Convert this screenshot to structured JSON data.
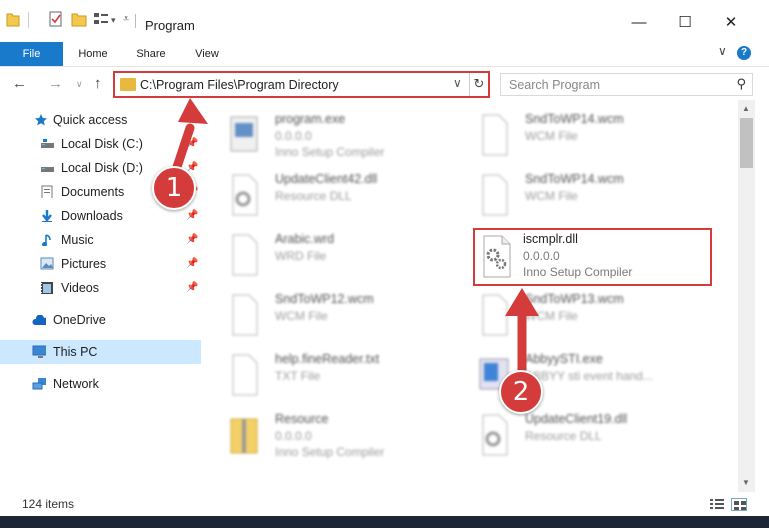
{
  "window": {
    "title": "Program",
    "minimize_glyph": "—",
    "maximize_glyph": "☐",
    "close_glyph": "✕"
  },
  "ribbon": {
    "tabs": [
      "File",
      "Home",
      "Share",
      "View"
    ],
    "expand_glyph": "∨",
    "help_glyph": "?"
  },
  "nav": {
    "back_glyph": "←",
    "forward_glyph": "→",
    "recent_glyph": "∨",
    "up_glyph": "↑",
    "address": "C:\\Program Files\\Program Directory",
    "address_dropdown_glyph": "∨",
    "refresh_glyph": "↻",
    "search_placeholder": "Search Program",
    "search_glyph": "⚲"
  },
  "sidebar": {
    "items": [
      {
        "label": "Quick access",
        "icon": "star-icon"
      },
      {
        "label": "Local Disk (C:)",
        "icon": "drive-icon",
        "pinned": true
      },
      {
        "label": "Local Disk (D:)",
        "icon": "drive-icon",
        "pinned": true
      },
      {
        "label": "Documents",
        "icon": "documents-icon",
        "pinned": true
      },
      {
        "label": "Downloads",
        "icon": "downloads-icon",
        "pinned": true
      },
      {
        "label": "Music",
        "icon": "music-icon",
        "pinned": true
      },
      {
        "label": "Pictures",
        "icon": "pictures-icon",
        "pinned": true
      },
      {
        "label": "Videos",
        "icon": "videos-icon",
        "pinned": true
      },
      {
        "label": "OneDrive",
        "icon": "onedrive-icon"
      },
      {
        "label": "This PC",
        "icon": "pc-icon",
        "selected": true
      },
      {
        "label": "Network",
        "icon": "network-icon"
      }
    ]
  },
  "files": {
    "left": [
      {
        "name": "program.exe",
        "line2": "0.0.0.0",
        "line3": "Inno Setup Compiler",
        "icon": "exe-icon"
      },
      {
        "name": "UpdateClient42.dll",
        "line2": "Resource DLL",
        "line3": "",
        "icon": "dll-icon"
      },
      {
        "name": "Arabic.wrd",
        "line2": "WRD File",
        "line3": "",
        "icon": "file-icon"
      },
      {
        "name": "SndToWP12.wcm",
        "line2": "WCM File",
        "line3": "",
        "icon": "file-icon"
      },
      {
        "name": "help.fineReader.txt",
        "line2": "TXT File",
        "line3": "",
        "icon": "file-icon"
      },
      {
        "name": "Resource",
        "line2": "0.0.0.0",
        "line3": "Inno Setup Compiler",
        "icon": "archive-icon"
      }
    ],
    "right": [
      {
        "name": "SndToWP14.wcm",
        "line2": "WCM File",
        "line3": "",
        "icon": "file-icon"
      },
      {
        "name": "SndToWP14.wcm",
        "line2": "WCM File",
        "line3": "",
        "icon": "file-icon"
      },
      {
        "name": "SndToWP13.wcm",
        "line2": "WCM File",
        "line3": "",
        "icon": "file-icon"
      },
      {
        "name": "AbbyySTI.exe",
        "line2": "ABBYY sti event hand...",
        "line3": "",
        "icon": "app-icon"
      },
      {
        "name": "UpdateClient19.dll",
        "line2": "Resource DLL",
        "line3": "",
        "icon": "dll-icon"
      }
    ],
    "highlighted": {
      "name": "iscmplr.dll",
      "line2": "0.0.0.0",
      "line3": "Inno Setup Compiler",
      "icon": "dll-gear-icon"
    }
  },
  "status": {
    "item_count": "124 items"
  },
  "annotations": {
    "step1": "1",
    "step2": "2"
  },
  "colors": {
    "accent": "#1979ca",
    "annotation_red": "#d43b3b",
    "selection": "#cce8ff",
    "folder": "#e8b93e"
  }
}
